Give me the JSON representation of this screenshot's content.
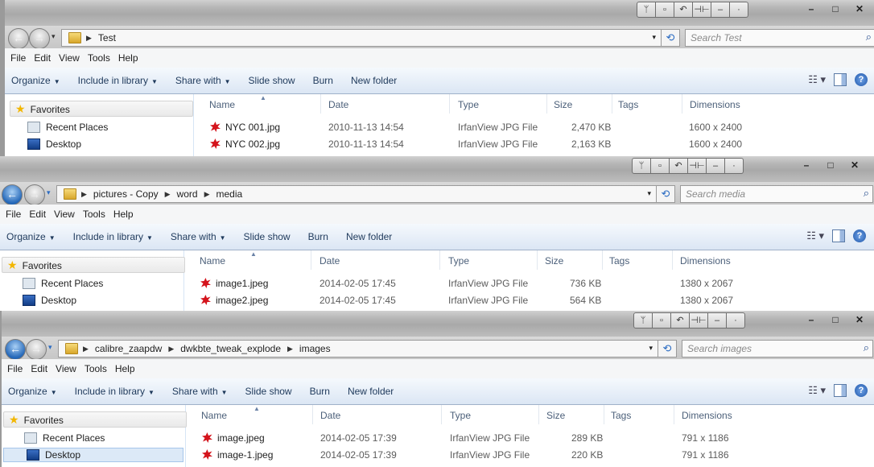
{
  "menu": [
    "File",
    "Edit",
    "View",
    "Tools",
    "Help"
  ],
  "commands": {
    "organize": "Organize",
    "include": "Include in library",
    "share": "Share with",
    "slideshow": "Slide show",
    "burn": "Burn",
    "newfolder": "New folder"
  },
  "nav": {
    "favorites": "Favorites",
    "recent": "Recent Places",
    "desktop": "Desktop"
  },
  "columns": {
    "name": "Name",
    "date": "Date",
    "type": "Type",
    "size": "Size",
    "tags": "Tags",
    "dimensions": "Dimensions"
  },
  "windows": [
    {
      "path": [
        "Test"
      ],
      "search_placeholder": "Search Test",
      "files": [
        {
          "name": "NYC 001.jpg",
          "date": "2010-11-13 14:54",
          "type": "IrfanView JPG File",
          "size": "2,470 KB",
          "dimensions": "1600 x 2400"
        },
        {
          "name": "NYC 002.jpg",
          "date": "2010-11-13 14:54",
          "type": "IrfanView JPG File",
          "size": "2,163 KB",
          "dimensions": "1600 x 2400"
        }
      ]
    },
    {
      "path": [
        "pictures - Copy",
        "word",
        "media"
      ],
      "search_placeholder": "Search media",
      "files": [
        {
          "name": "image1.jpeg",
          "date": "2014-02-05 17:45",
          "type": "IrfanView JPG File",
          "size": "736 KB",
          "dimensions": "1380 x 2067"
        },
        {
          "name": "image2.jpeg",
          "date": "2014-02-05 17:45",
          "type": "IrfanView JPG File",
          "size": "564 KB",
          "dimensions": "1380 x 2067"
        }
      ]
    },
    {
      "path": [
        "calibre_zaapdw",
        "dwkbte_tweak_explode",
        "images"
      ],
      "search_placeholder": "Search images",
      "files": [
        {
          "name": "image.jpeg",
          "date": "2014-02-05 17:39",
          "type": "IrfanView JPG File",
          "size": "289 KB",
          "dimensions": "791 x 1186"
        },
        {
          "name": "image-1.jpeg",
          "date": "2014-02-05 17:39",
          "type": "IrfanView JPG File",
          "size": "220 KB",
          "dimensions": "791 x 1186"
        }
      ]
    }
  ]
}
